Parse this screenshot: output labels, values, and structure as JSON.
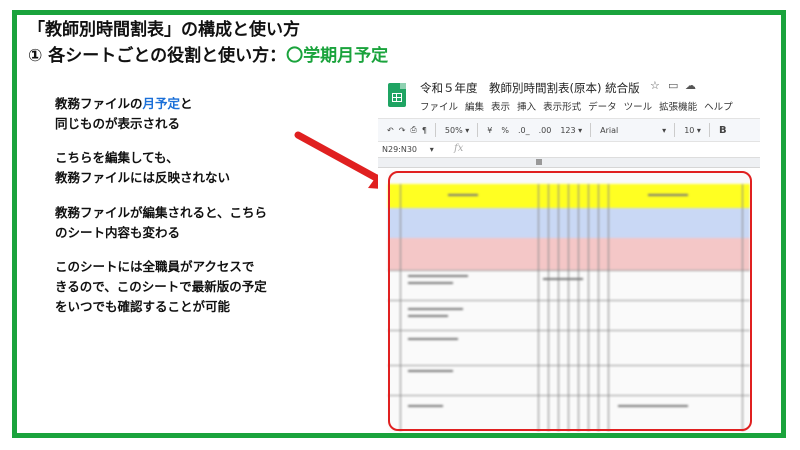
{
  "slide": {
    "title_line1": "「教師別時間割表」の構成と使い方",
    "title_line2_prefix": "①  各シートごとの役割と使い方：",
    "title_line2_accent": "〇学期月予定",
    "accent_color": "#1aa33c"
  },
  "description": {
    "p1_line1_pre": "教務ファイルの",
    "p1_line1_hl": "月予定",
    "p1_line1_post": "と",
    "p1_line2": "同じものが表示される",
    "p2_line1": "こちらを編集しても、",
    "p2_line2": "教務ファイルには反映されない",
    "p3_line1": "教務ファイルが編集されると、こちら",
    "p3_line2": "のシート内容も変わる",
    "p4_line1": "このシートには全職員がアクセスで",
    "p4_line2": "きるので、このシートで最新版の予定",
    "p4_line3": "をいつでも確認することが可能"
  },
  "spreadsheet": {
    "doc_title": "令和５年度　教師別時間割表(原本)  統合版",
    "title_icons": [
      "star-icon",
      "folder-icon",
      "cloud-icon"
    ],
    "menus": [
      "ファイル",
      "編集",
      "表示",
      "挿入",
      "表示形式",
      "データ",
      "ツール",
      "拡張機能",
      "ヘルプ"
    ],
    "toolbar": {
      "zoom": "50%",
      "currency": "¥",
      "percent": "%",
      "dec_decrease": ".0_",
      "dec_increase": ".00",
      "number_format": "123",
      "font": "Arial",
      "font_size": "10",
      "bold": "B"
    },
    "name_box": "N29:N30",
    "fx_label": "fx",
    "row_colors": {
      "header": "#ffff22",
      "blue": "#c9d8f5",
      "pink": "#f4c7c7"
    }
  }
}
